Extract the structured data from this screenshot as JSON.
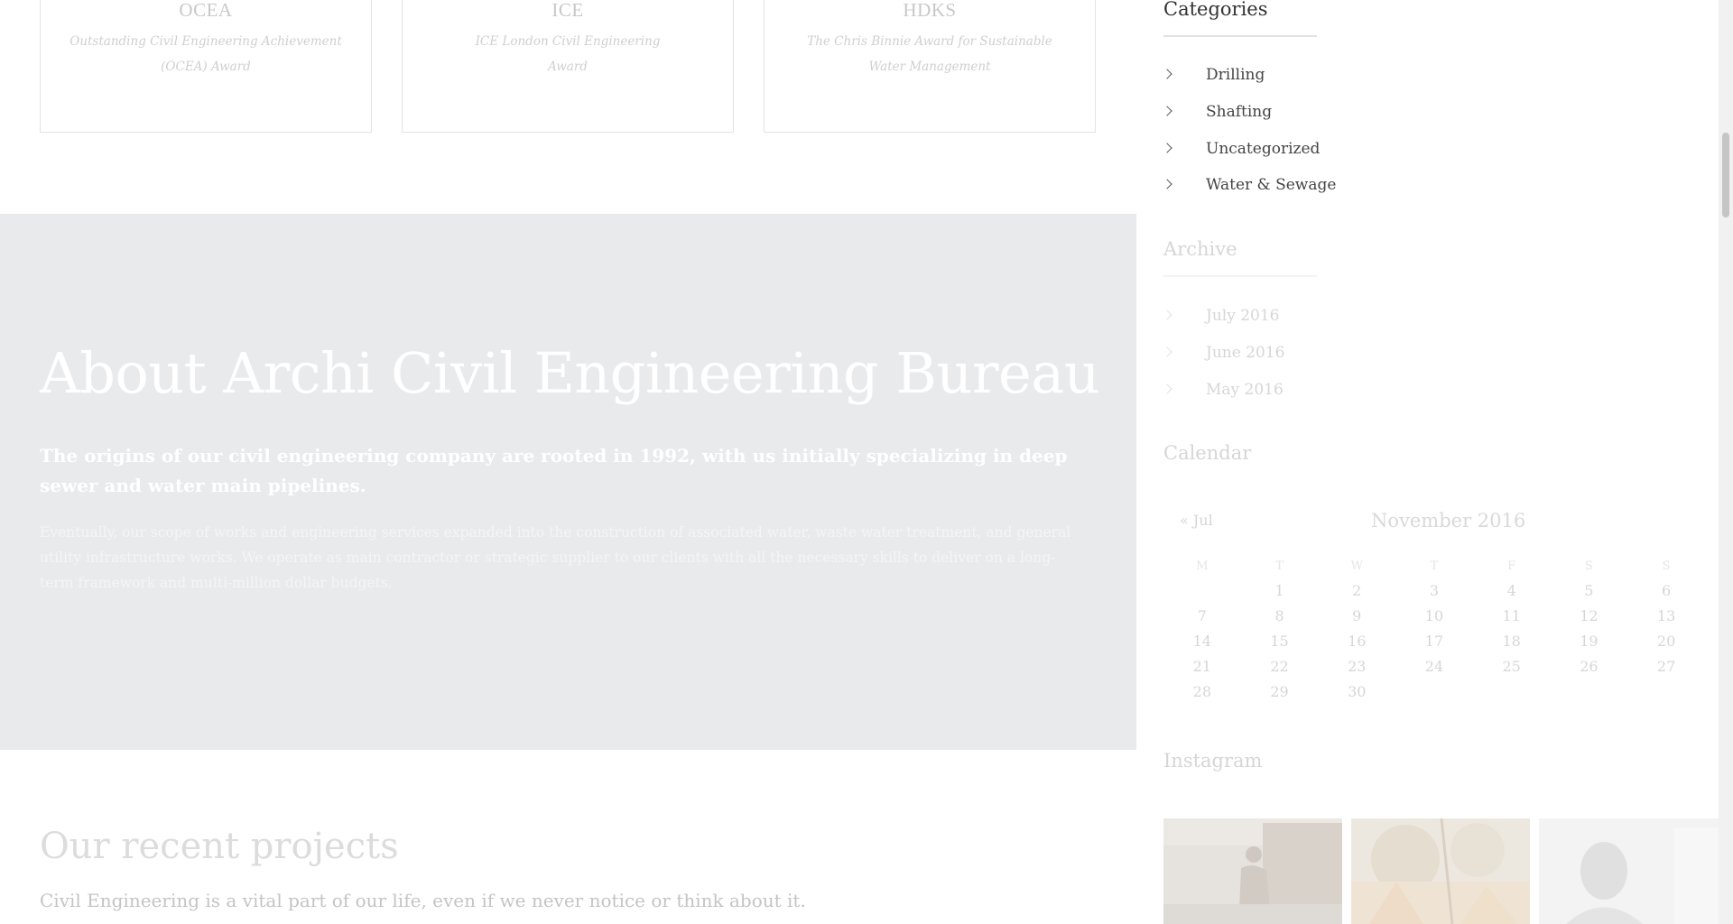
{
  "awards": [
    {
      "abbr": "OCEA",
      "desc": "Outstanding Civil Engineering Achievement (OCEA) Award"
    },
    {
      "abbr": "ICE",
      "desc": "ICE London Civil Engineering Award"
    },
    {
      "abbr": "HDKS",
      "desc": "The Chris Binnie Award for Sustainable Water Management"
    }
  ],
  "about": {
    "title": "About Archi Civil Engineering Bureau",
    "lead": "The origins of our civil engineering company are rooted in 1992, with us initially specializing in deep sewer and water main pipelines.",
    "body": "Eventually, our scope of works and engineering services expanded into the construction of associated water, waste water treatment, and general utility infrastructure works. We operate as main contractor or strategic supplier to our clients with all the necessary skills to deliver on a long-term framework and multi-million dollar budgets."
  },
  "recent": {
    "title": "Our recent projects",
    "text": "Civil Engineering is a vital part of our life, even if we never notice or think about it."
  },
  "sidebar": {
    "categories": {
      "title": "Categories",
      "items": [
        {
          "label": "Drilling"
        },
        {
          "label": "Shafting"
        },
        {
          "label": "Uncategorized"
        },
        {
          "label": "Water & Sewage"
        }
      ]
    },
    "archive": {
      "title": "Archive",
      "items": [
        {
          "label": "July 2016"
        },
        {
          "label": "June 2016"
        },
        {
          "label": "May 2016"
        }
      ]
    },
    "calendar": {
      "title": "Calendar",
      "prev": "« Jul",
      "month": "November 2016",
      "weekdays": [
        "M",
        "T",
        "W",
        "T",
        "F",
        "S",
        "S"
      ],
      "weeks": [
        [
          "",
          "1",
          "2",
          "3",
          "4",
          "5",
          "6"
        ],
        [
          "7",
          "8",
          "9",
          "10",
          "11",
          "12",
          "13"
        ],
        [
          "14",
          "15",
          "16",
          "17",
          "18",
          "19",
          "20"
        ],
        [
          "21",
          "22",
          "23",
          "24",
          "25",
          "26",
          "27"
        ],
        [
          "28",
          "29",
          "30",
          "",
          "",
          "",
          ""
        ]
      ]
    },
    "instagram": {
      "title": "Instagram"
    }
  },
  "colors": {
    "about_bg": "#e9eaec",
    "text_dark": "#333333",
    "text_faded": "#d6d6d6"
  }
}
